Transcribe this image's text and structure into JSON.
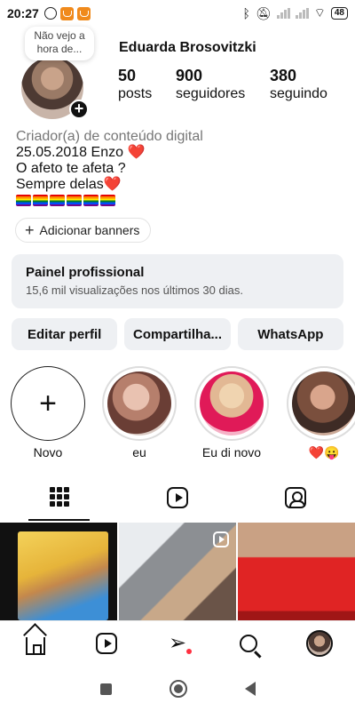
{
  "status_bar": {
    "time": "20:27",
    "battery": "48",
    "icons": [
      "whatsapp-icon",
      "app-notification-icon",
      "app-notification-icon",
      "bluetooth-icon",
      "mute-icon",
      "signal-icon",
      "signal-icon",
      "wifi-icon",
      "battery-icon"
    ]
  },
  "profile": {
    "note": "Não vejo a hora de...",
    "username": "Eduarda Brosovitzki",
    "stats": [
      {
        "value": "50",
        "label": "posts"
      },
      {
        "value": "900",
        "label": "seguidores"
      },
      {
        "value": "380",
        "label": "seguindo"
      }
    ],
    "category": "Criador(a) de conteúdo digital",
    "bio_lines": [
      "25.05.2018 Enzo ",
      "O afeto te afeta ?",
      "Sempre delas"
    ],
    "bio_hearts": [
      "❤️",
      "❤️"
    ],
    "flags_count": 6,
    "add_banners": "Adicionar banners"
  },
  "pro_panel": {
    "title": "Painel profissional",
    "subtitle": "15,6 mil visualizações nos últimos 30 dias."
  },
  "actions": [
    "Editar perfil",
    "Compartilha...",
    "WhatsApp"
  ],
  "highlights": [
    {
      "label": "Novo"
    },
    {
      "label": "eu"
    },
    {
      "label": "Eu di novo"
    },
    {
      "label": "❤️😛"
    }
  ],
  "tabs": [
    "grid-icon",
    "reels-icon",
    "tagged-icon"
  ],
  "bottom_nav": [
    "home-icon",
    "reels-icon",
    "send-icon",
    "search-icon",
    "profile-avatar"
  ],
  "colors": {
    "button_bg": "#eef0f3",
    "notification_dot": "#ff3040",
    "heart": "#e0152c"
  }
}
